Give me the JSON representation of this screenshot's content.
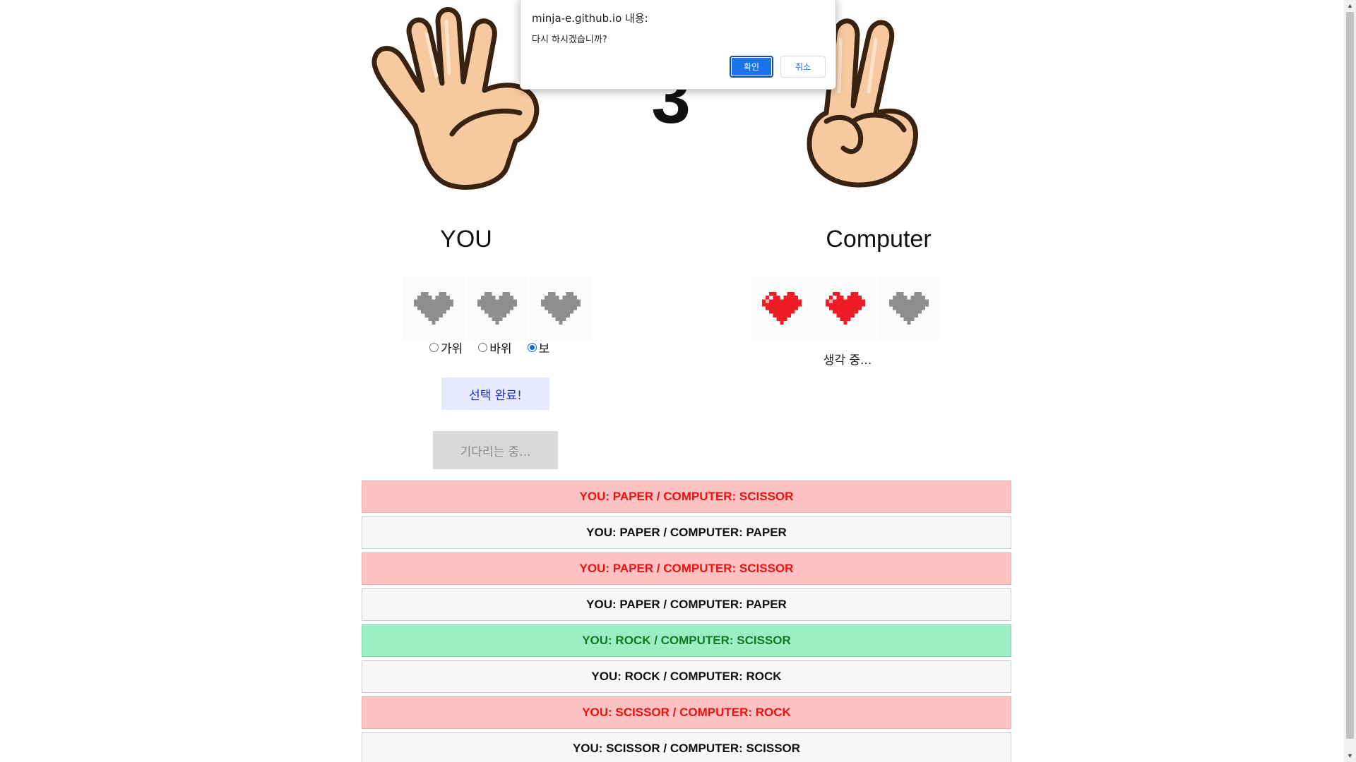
{
  "game": {
    "countdown": "3",
    "player_label": "YOU",
    "computer_label": "Computer",
    "player_hand": "paper-hand-icon",
    "computer_hand": "scissor-hand-icon",
    "player_hearts_filled": 0,
    "computer_hearts_filled": 2,
    "hearts_total": 3,
    "colors": {
      "heart_full": "#ee1c24",
      "heart_empty": "#8e8e8e"
    },
    "choices": [
      {
        "label": "가위",
        "checked": false
      },
      {
        "label": "바위",
        "checked": false
      },
      {
        "label": "보",
        "checked": true
      }
    ],
    "submit_label": "선택 완료!",
    "waiting_label": "기다리는 중...",
    "computer_status": "생각 중..."
  },
  "history": [
    {
      "text": "YOU: PAPER / COMPUTER: SCISSOR",
      "result": "lose"
    },
    {
      "text": "YOU: PAPER / COMPUTER: PAPER",
      "result": "draw"
    },
    {
      "text": "YOU: PAPER / COMPUTER: SCISSOR",
      "result": "lose"
    },
    {
      "text": "YOU: PAPER / COMPUTER: PAPER",
      "result": "draw"
    },
    {
      "text": "YOU: ROCK / COMPUTER: SCISSOR",
      "result": "win"
    },
    {
      "text": "YOU: ROCK / COMPUTER: ROCK",
      "result": "draw"
    },
    {
      "text": "YOU: SCISSOR / COMPUTER: ROCK",
      "result": "lose"
    },
    {
      "text": "YOU: SCISSOR / COMPUTER: SCISSOR",
      "result": "draw"
    }
  ],
  "dialog": {
    "origin": "minja-e.github.io 내용:",
    "message": "다시 하시겠습니까?",
    "ok_label": "확인",
    "cancel_label": "취소"
  }
}
